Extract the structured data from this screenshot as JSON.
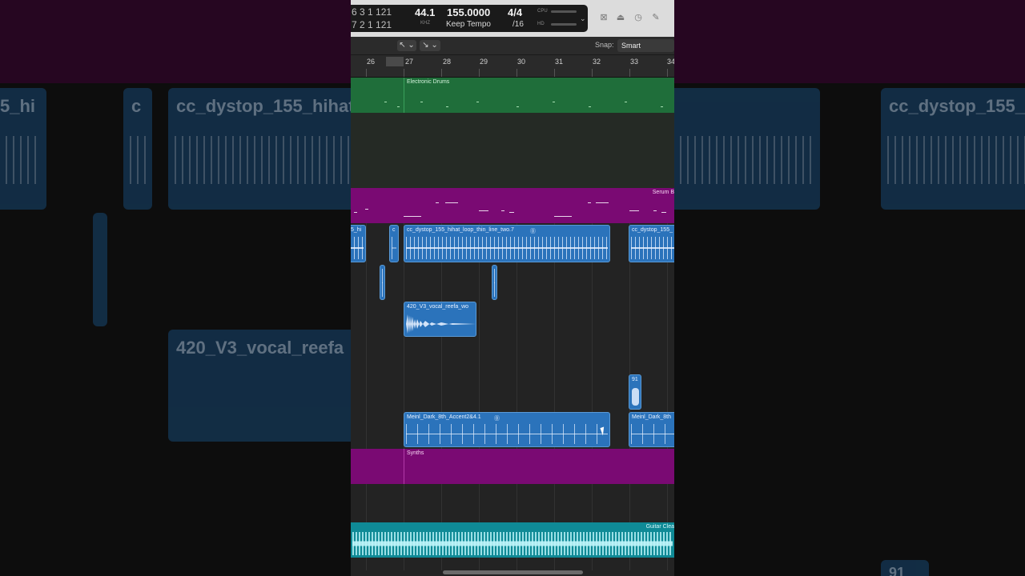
{
  "transport": {
    "pos_row1": "6  3  1  121",
    "pos_row2": "7  2  1  121",
    "sample_rate": "44.1",
    "sample_rate_unit": "KHZ",
    "tempo": "155.0000",
    "tempo_mode": "Keep Tempo",
    "time_sig": "4/4",
    "division": "/16",
    "cpu_label": "CPU",
    "hd_label": "HD"
  },
  "toolbar": {
    "snap_label": "Snap:",
    "snap_value": "Smart"
  },
  "ruler": {
    "bars": [
      "26",
      "27",
      "28",
      "29",
      "30",
      "31",
      "32",
      "33",
      "34"
    ]
  },
  "tracks": {
    "electronic_drums": "Electronic Drums",
    "serum": "Serum B",
    "hihat_left": "5_hi",
    "hihat_small": "c",
    "hihat_main": "cc_dystop_155_hihat_loop_thin_line_two.7",
    "hihat_right": "cc_dystop_155_",
    "vocal": "420_V3_vocal_reefa_wo",
    "short_91": "91",
    "meinl_main": "Meinl_Dark_8th_Accent2&4.1",
    "meinl_right": "Meinl_Dark_8th",
    "synths": "Synths",
    "guitar": "Guitar Clea"
  },
  "background": {
    "left_tile1": "5_hi",
    "left_tile2": "c",
    "left_tile3": "cc_dystop_155_hihat",
    "left_tile4": "420_V3_vocal_reefa",
    "right_tile1": "cc_dystop_155_",
    "right_corner": "91"
  },
  "colors": {
    "audio_region": "#2b73bb",
    "drums_region": "#1f6e3a",
    "midi_region": "#7a0a73",
    "guitar_region": "#0f8a96"
  }
}
